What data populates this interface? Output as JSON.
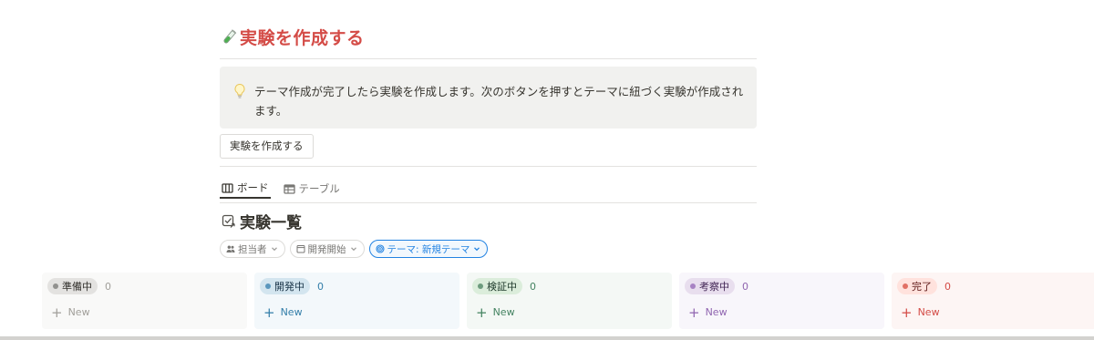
{
  "page": {
    "heading_emoji": "test-tube-emoji",
    "heading": "実験を作成する"
  },
  "callout": {
    "icon": "lightbulb-icon",
    "text": "テーマ作成が完了したら実験を作成します。次のボタンを押すとテーマに紐づく実験が作成されます。"
  },
  "create_button": {
    "label": "実験を作成する"
  },
  "tabs": [
    {
      "label": "ボード",
      "icon": "board-icon",
      "active": true
    },
    {
      "label": "テーブル",
      "icon": "table-icon",
      "active": false
    }
  ],
  "database": {
    "icon": "checkbox-arrow-icon",
    "title": "実験一覧"
  },
  "filters": [
    {
      "label": "担当者",
      "icon": "people-icon",
      "active": false
    },
    {
      "label": "開発開始",
      "icon": "calendar-icon",
      "active": false
    },
    {
      "label": "テーマ: 新規テーマ",
      "icon": "target-icon",
      "active": true
    }
  ],
  "board": {
    "columns": [
      {
        "name": "準備中",
        "count": "0",
        "new_label": "New",
        "bg": "#f9f9f8",
        "pill_bg": "#e3e2e0",
        "pill_text": "#32302c",
        "dot": "#91918e",
        "count_color": "#a19f9a",
        "new_color": "#a19f9a"
      },
      {
        "name": "開発中",
        "count": "0",
        "new_label": "New",
        "bg": "#f3f8fb",
        "pill_bg": "#d3e5ef",
        "pill_text": "#183347",
        "dot": "#5b97bd",
        "count_color": "#337ea9",
        "new_color": "#337ea9"
      },
      {
        "name": "検証中",
        "count": "0",
        "new_label": "New",
        "bg": "#f4f8f5",
        "pill_bg": "#dbeddb",
        "pill_text": "#1c3829",
        "dot": "#6c9b7d",
        "count_color": "#448361",
        "new_color": "#448361"
      },
      {
        "name": "考察中",
        "count": "0",
        "new_label": "New",
        "bg": "#f8f6fb",
        "pill_bg": "#e8deee",
        "pill_text": "#412454",
        "dot": "#a782c3",
        "count_color": "#9065b0",
        "new_color": "#9065b0"
      },
      {
        "name": "完了",
        "count": "0",
        "new_label": "New",
        "bg": "#fdf5f4",
        "pill_bg": "#ffe2dd",
        "pill_text": "#5d1715",
        "dot": "#e16f64",
        "count_color": "#d44c47",
        "new_color": "#d44c47"
      }
    ]
  }
}
